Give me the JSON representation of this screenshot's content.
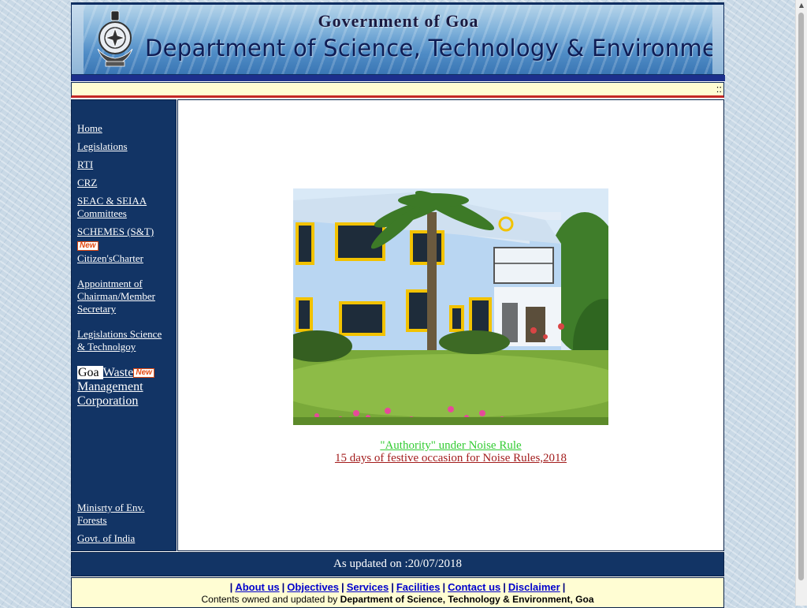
{
  "header": {
    "line1": "Government of Goa",
    "line2": "Department of Science, Technology & Environment"
  },
  "marquee": {
    "text": "::"
  },
  "sidebar": {
    "items": [
      {
        "label": "Home"
      },
      {
        "label": "Legislations"
      },
      {
        "label": "RTI"
      },
      {
        "label": "CRZ"
      },
      {
        "label": "SEAC & SEIAA Committees"
      },
      {
        "label": "SCHEMES (S&T)",
        "badge": "New"
      },
      {
        "label": "Citizen'sCharter"
      },
      {
        "label": "Appointment of Chairman/Member Secretary"
      },
      {
        "label": "Legislations Science & Technolgoy"
      },
      {
        "label_goa": "Goa",
        "label_rest": "Waste",
        "badge": "New",
        "label_tail": "Management Corporation"
      },
      {
        "label": "Minisrty of Env. Forests"
      },
      {
        "label": "Govt. of India"
      }
    ]
  },
  "main": {
    "notice1": "\"Authority\" under Noise Rule",
    "notice2": "15 days of festive occasion for Noise Rules,2018"
  },
  "updated": {
    "text": "As updated on :20/07/2018"
  },
  "footer": {
    "links": [
      "About us",
      "Objectives",
      "Services",
      "Facilities",
      "Contact us",
      "Disclaimer"
    ],
    "owner_prefix": "Contents owned and updated by",
    "owner_name": "Department of Science, Technology & Environment, Goa"
  },
  "colors": {
    "nav_bg": "#123465",
    "marquee_bg": "#fffcd3",
    "notice1": "#33cc33",
    "notice2": "#a31d1d"
  }
}
